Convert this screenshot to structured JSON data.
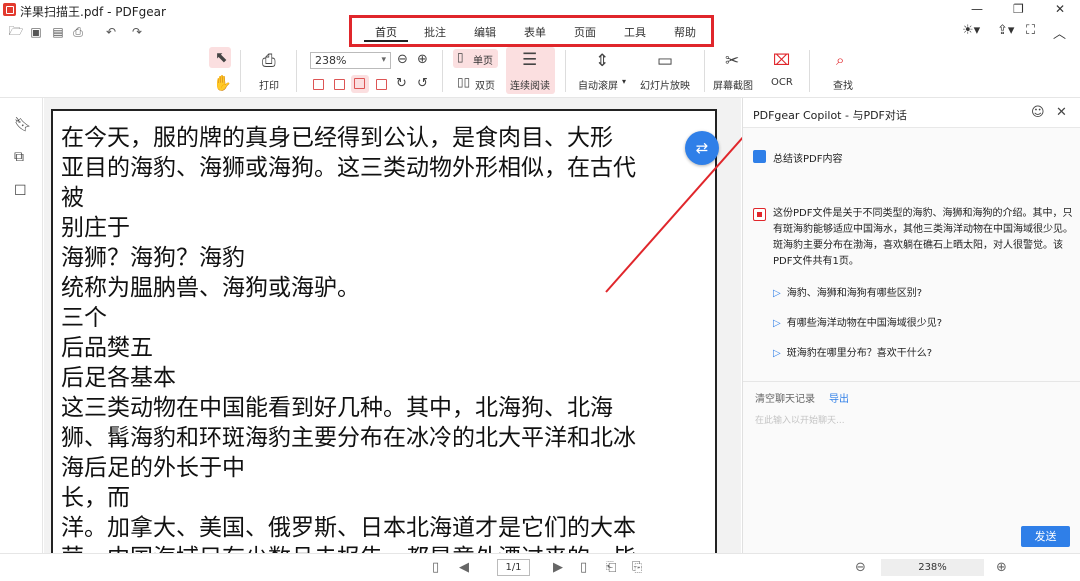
{
  "window": {
    "title": "洋果扫描王.pdf - PDFgear"
  },
  "menu": {
    "items": [
      "首页",
      "批注",
      "编辑",
      "表单",
      "页面",
      "工具",
      "帮助"
    ]
  },
  "toolbar": {
    "print_label": "打印",
    "zoom_value": "238%",
    "single_page_label": "单页",
    "double_page_label": "双页",
    "continuous_label": "连续阅读",
    "auto_scroll_label": "自动滚屏",
    "slideshow_label": "幻灯片放映",
    "screenshot_label": "屏幕截图",
    "ocr_label": "OCR",
    "find_label": "查找"
  },
  "document": {
    "lines": [
      "在今天，服的牌的真身已经得到公认，是食肉目、大形",
      "亚目的海豹、海狮或海狗。这三类动物外形相似，在古代",
      "被",
      "别庄于",
      "海狮？海狗？海豹",
      "统称为腽肭兽、海狗或海驴。",
      "三个",
      "后品樊五",
      "后足各基本",
      "这三类动物在中国能看到好几种。其中，北海狗、北海",
      "狮、髯海豹和环斑海豹主要分布在冰冷的北大平洋和北冰",
      "海后足的外长于中",
      "长，而",
      "洋。加拿大、美国、俄罗斯、日本北海道才是它们的大本",
      "营。中国海域只有少数且击报告，都是意外漂过来的，毕"
    ]
  },
  "copilot": {
    "title": "PDFgear Copilot - 与PDF对话",
    "summarize_label": "总结该PDF内容",
    "answer": "这份PDF文件是关于不同类型的海豹、海狮和海狗的介绍。其中，只有斑海豹能够适应中国海水，其他三类海洋动物在中国海域很少见。斑海豹主要分布在渤海，喜欢躺在礁石上晒太阳，对人很警觉。该PDF文件共有1页。",
    "suggestions": [
      "海豹、海狮和海狗有哪些区别?",
      "有哪些海洋动物在中国海域很少见?",
      "斑海豹在哪里分布？喜欢干什么?"
    ],
    "clear_label": "清空聊天记录",
    "export_label": "导出",
    "input_placeholder": "在此输入以开始聊天...",
    "send_label": "发送"
  },
  "status": {
    "page": "1/1",
    "zoom": "238%"
  },
  "colors": {
    "accent": "#2f7fe8",
    "highlight": "#e0262b"
  }
}
